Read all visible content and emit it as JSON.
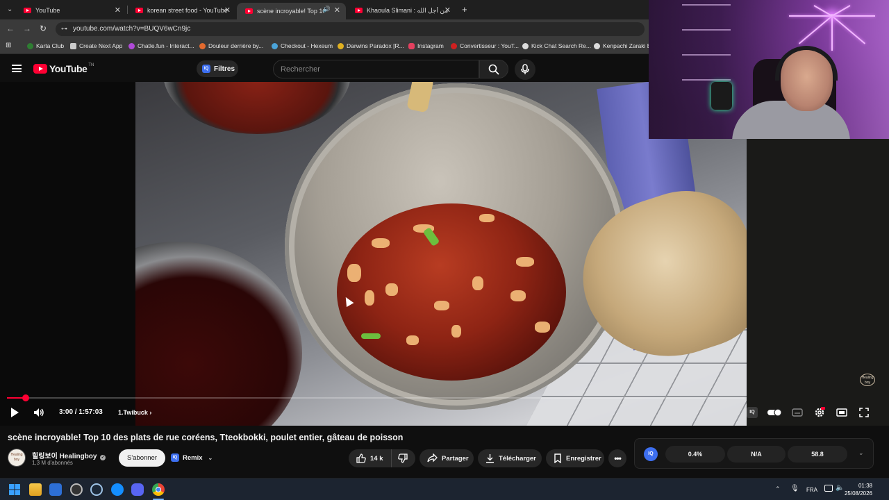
{
  "browser": {
    "tabs": [
      {
        "title": "YouTube",
        "active": false
      },
      {
        "title": "korean street food - YouTube",
        "active": false
      },
      {
        "title": "scène incroyable! Top 10 de",
        "active": true
      },
      {
        "title": "Khaoula Slimani : يه من أجل الله",
        "active": false
      }
    ],
    "new_tab": "+",
    "url": "youtube.com/watch?v=BUQV6wCn9jc",
    "bookmarks": [
      {
        "label": "Karta Club",
        "color": "#2e7d32"
      },
      {
        "label": "Create Next App",
        "color": "#cccccc"
      },
      {
        "label": "Chatle.fun - Interact...",
        "color": "#b04ad8"
      },
      {
        "label": "Douleur derrière by...",
        "color": "#e36a2e"
      },
      {
        "label": "Checkout - Hexeum",
        "color": "#4aa3d8"
      },
      {
        "label": "Darwins Paradox [R...",
        "color": "#e0b020"
      },
      {
        "label": "Instagram",
        "color": "#e4405f"
      },
      {
        "label": "Convertisseur : YouT...",
        "color": "#d02020"
      },
      {
        "label": "Kick Chat Search Re...",
        "color": "#dddddd"
      },
      {
        "label": "Kenpachi Zaraki Bl",
        "color": "#dddddd"
      }
    ]
  },
  "youtube": {
    "logo_text": "YouTube",
    "logo_tm": "TN",
    "filters_label": "Filtres",
    "filters_badge": "IQ",
    "search_placeholder": "Rechercher"
  },
  "player": {
    "current_time": "3:00",
    "duration": "1:57:03",
    "time_display": "3:00 / 1:57:03",
    "progress_fraction": 0.0256,
    "chapter": "1.Twibuck",
    "watermark": "Healing boy"
  },
  "video": {
    "title": "scène incroyable! Top 10 des plats de rue coréens, Tteokbokki, poulet entier, gâteau de poisson",
    "channel_name": "힐링보이 Healingboy",
    "channel_verified": true,
    "subscribers": "1,3 M d'abonnés",
    "avatar_text": "Healing boy",
    "subscribe_label": "S'abonner",
    "remix_label": "Remix",
    "remix_badge": "IQ",
    "likes": "14 k",
    "share_label": "Partager",
    "download_label": "Télécharger",
    "save_label": "Enregistrer"
  },
  "iq_panel": {
    "logo": "IQ",
    "stats": [
      "0.4%",
      "N/A",
      "58.8"
    ]
  },
  "taskbar": {
    "language": "FRA",
    "time": "01:38",
    "date": "25/08/2026"
  }
}
